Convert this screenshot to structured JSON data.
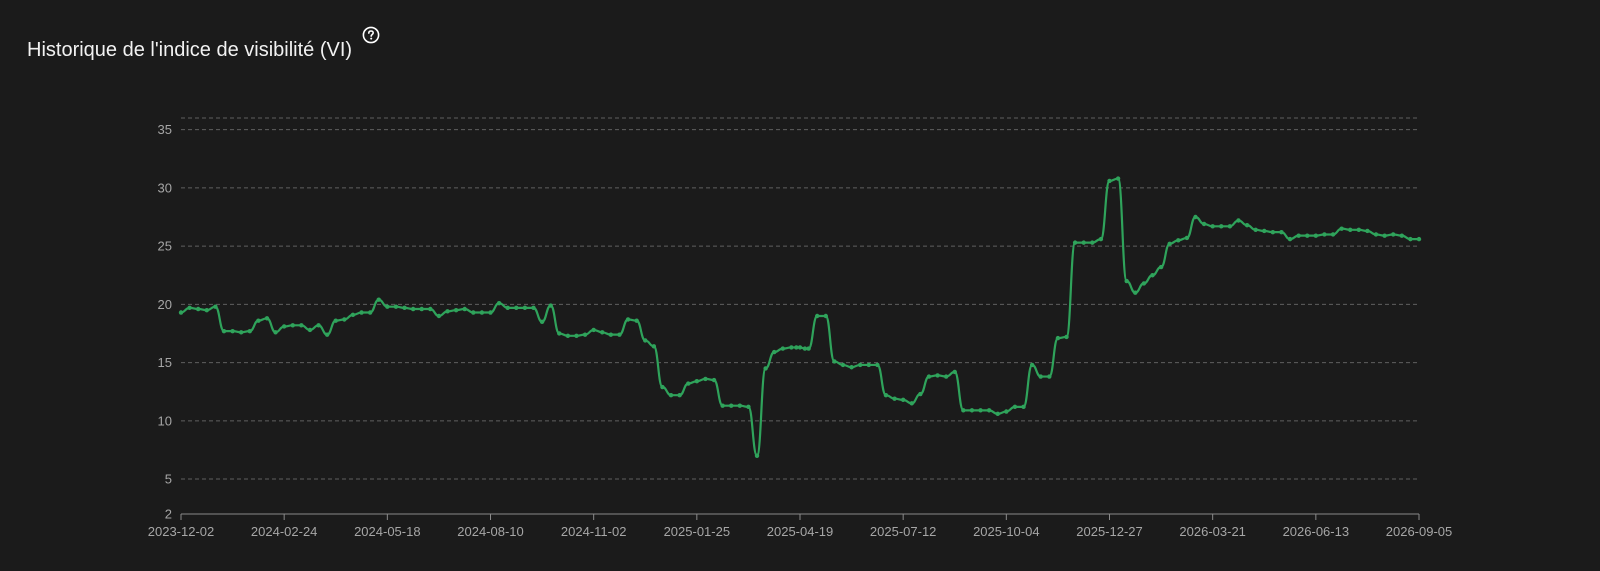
{
  "header": {
    "title": "Historique de l'indice de visibilité (VI)",
    "help_icon": "question-circle-icon"
  },
  "colors": {
    "background": "#1b1b1b",
    "line": "#2fa35b",
    "grid": "#5f5f5f",
    "tick_text": "#a6a6a6"
  },
  "chart_data": {
    "type": "line",
    "title": "Historique de l'indice de visibilité (VI)",
    "xlabel": "",
    "ylabel": "",
    "grid": true,
    "xlim": [
      "2023-12-02",
      "2026-09-05"
    ],
    "ylim": [
      2,
      36
    ],
    "x_ticks": [
      "2023-12-02",
      "2024-02-24",
      "2024-05-18",
      "2024-08-10",
      "2024-11-02",
      "2025-01-25",
      "2025-04-19",
      "2025-07-12",
      "2025-10-04",
      "2025-12-27",
      "2026-03-21",
      "2026-06-13",
      "2026-09-05"
    ],
    "y_ticks": [
      2,
      5,
      10,
      15,
      20,
      25,
      30,
      35
    ],
    "series": [
      {
        "x": [
          "2023-12-02",
          "2023-12-09",
          "2023-12-16",
          "2023-12-23",
          "2023-12-30",
          "2024-01-06",
          "2024-01-13",
          "2024-01-20",
          "2024-01-27",
          "2024-02-03",
          "2024-02-10",
          "2024-02-17",
          "2024-02-24",
          "2024-03-02",
          "2024-03-09",
          "2024-03-16",
          "2024-03-23",
          "2024-03-30",
          "2024-04-06",
          "2024-04-13",
          "2024-04-20",
          "2024-04-27",
          "2024-05-04",
          "2024-05-11",
          "2024-05-18",
          "2024-05-25",
          "2024-06-01",
          "2024-06-08",
          "2024-06-15",
          "2024-06-22",
          "2024-06-29",
          "2024-07-06",
          "2024-07-13",
          "2024-07-20",
          "2024-07-27",
          "2024-08-03",
          "2024-08-10",
          "2024-08-17",
          "2024-08-24",
          "2024-08-31",
          "2024-09-07",
          "2024-09-14",
          "2024-09-21",
          "2024-09-28",
          "2024-10-05",
          "2024-10-12",
          "2024-10-19",
          "2024-10-26",
          "2024-11-02",
          "2024-11-09",
          "2024-11-16",
          "2024-11-23",
          "2024-11-30",
          "2024-12-07",
          "2024-12-14",
          "2024-12-21",
          "2024-12-28",
          "2025-01-04",
          "2025-01-11",
          "2025-01-18",
          "2025-01-25",
          "2025-02-01",
          "2025-02-08",
          "2025-02-15",
          "2025-02-22",
          "2025-03-01",
          "2025-03-08",
          "2025-03-15",
          "2025-03-22",
          "2025-03-29",
          "2025-04-05",
          "2025-04-12",
          "2025-04-16",
          "2025-04-19",
          "2025-04-23",
          "2025-04-26",
          "2025-05-03",
          "2025-05-10",
          "2025-05-17",
          "2025-05-24",
          "2025-05-31",
          "2025-06-07",
          "2025-06-14",
          "2025-06-21",
          "2025-06-28",
          "2025-07-05",
          "2025-07-12",
          "2025-07-19",
          "2025-07-26",
          "2025-08-02",
          "2025-08-09",
          "2025-08-16",
          "2025-08-23",
          "2025-08-30",
          "2025-09-06",
          "2025-09-13",
          "2025-09-20",
          "2025-09-27",
          "2025-10-04",
          "2025-10-11",
          "2025-10-18",
          "2025-10-25",
          "2025-11-01",
          "2025-11-08",
          "2025-11-15",
          "2025-11-22",
          "2025-11-29",
          "2025-12-06",
          "2025-12-13",
          "2025-12-20",
          "2025-12-27",
          "2026-01-03",
          "2026-01-10",
          "2026-01-17",
          "2026-01-24",
          "2026-01-31",
          "2026-02-07",
          "2026-02-14",
          "2026-02-21",
          "2026-02-28",
          "2026-03-07",
          "2026-03-14",
          "2026-03-21",
          "2026-03-28",
          "2026-04-04",
          "2026-04-11",
          "2026-04-18",
          "2026-04-25",
          "2026-05-02",
          "2026-05-09",
          "2026-05-16",
          "2026-05-23",
          "2026-05-30",
          "2026-06-06",
          "2026-06-13",
          "2026-06-20",
          "2026-06-27",
          "2026-07-04",
          "2026-07-11",
          "2026-07-18",
          "2026-07-25",
          "2026-08-01",
          "2026-08-08",
          "2026-08-15",
          "2026-08-22",
          "2026-08-29",
          "2026-09-05"
        ],
        "y": [
          19.3,
          19.7,
          19.6,
          19.5,
          19.8,
          17.7,
          17.7,
          17.6,
          17.7,
          18.6,
          18.8,
          17.6,
          18.1,
          18.2,
          18.2,
          17.8,
          18.2,
          17.4,
          18.6,
          18.7,
          19.1,
          19.3,
          19.3,
          20.4,
          19.8,
          19.8,
          19.7,
          19.6,
          19.6,
          19.6,
          19.0,
          19.4,
          19.5,
          19.6,
          19.3,
          19.3,
          19.3,
          20.1,
          19.7,
          19.7,
          19.7,
          19.7,
          18.5,
          19.9,
          17.5,
          17.3,
          17.3,
          17.4,
          17.8,
          17.6,
          17.4,
          17.4,
          18.7,
          18.6,
          16.9,
          16.4,
          12.9,
          12.2,
          12.2,
          13.2,
          13.4,
          13.6,
          13.5,
          11.3,
          11.3,
          11.3,
          11.2,
          7.0,
          14.5,
          15.9,
          16.2,
          16.3,
          16.3,
          16.3,
          16.2,
          16.2,
          19.0,
          19.0,
          15.1,
          14.8,
          14.6,
          14.8,
          14.8,
          14.8,
          12.2,
          11.9,
          11.8,
          11.5,
          12.3,
          13.8,
          13.9,
          13.8,
          14.2,
          10.9,
          10.9,
          10.9,
          10.9,
          10.6,
          10.8,
          11.2,
          11.2,
          14.8,
          13.8,
          13.8,
          17.1,
          17.2,
          25.3,
          25.3,
          25.3,
          25.6,
          30.6,
          30.8,
          22.0,
          21.0,
          21.8,
          22.5,
          23.2,
          25.2,
          25.5,
          25.7,
          27.5,
          26.9,
          26.7,
          26.7,
          26.7,
          27.2,
          26.8,
          26.4,
          26.3,
          26.2,
          26.2,
          25.6,
          25.9,
          25.9,
          25.9,
          26.0,
          26.0,
          26.5,
          26.4,
          26.4,
          26.3,
          26.0,
          25.9,
          26.0,
          25.9,
          25.6,
          25.6
        ]
      }
    ]
  }
}
